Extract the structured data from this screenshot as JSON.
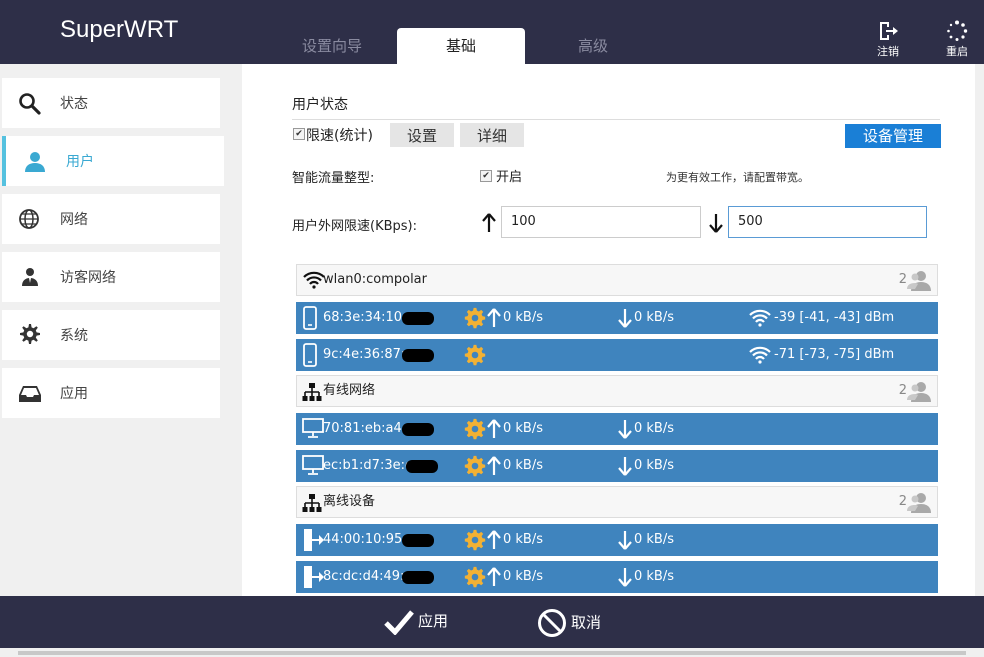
{
  "app": {
    "title": "SuperWRT"
  },
  "tabs": [
    {
      "label": "设置向导"
    },
    {
      "label": "基础",
      "active": true
    },
    {
      "label": "高级"
    }
  ],
  "top_actions": {
    "logout": "注销",
    "reboot": "重启"
  },
  "sidebar": {
    "items": [
      {
        "label": "状态",
        "icon": "search-icon"
      },
      {
        "label": "用户",
        "icon": "user-icon",
        "active": true
      },
      {
        "label": "网络",
        "icon": "globe-icon"
      },
      {
        "label": "访客网络",
        "icon": "guest-icon"
      },
      {
        "label": "系统",
        "icon": "gear-icon"
      },
      {
        "label": "应用",
        "icon": "inbox-icon"
      }
    ]
  },
  "user_status": {
    "title": "用户状态",
    "rate_limit_label": "限速(统计)",
    "rate_limit_checked": true,
    "settings_button": "设置",
    "details_button": "详细",
    "device_manage_button": "设备管理",
    "smart_shaping_label": "智能流量整型:",
    "smart_shaping_enable": "开启",
    "smart_shaping_checked": true,
    "bandwidth_hint": "为更有效工作，请配置带宽。",
    "limit_label": "用户外网限速(KBps):",
    "up_limit": "100",
    "down_limit": "500"
  },
  "groups": [
    {
      "name": "wlan0:compolar",
      "count": "2",
      "icon": "wifi-icon",
      "devices": [
        {
          "mac": "68:3e:34:10:",
          "type": "phone",
          "up": "0 kB/s",
          "down": "0 kB/s",
          "signal": "-39 [-41, -43] dBm"
        },
        {
          "mac": "9c:4e:36:87:",
          "type": "phone",
          "up": "",
          "down": "",
          "signal": "-71 [-73, -75] dBm"
        }
      ]
    },
    {
      "name": "有线网络",
      "count": "2",
      "icon": "network-icon",
      "devices": [
        {
          "mac": "70:81:eb:a4:",
          "type": "monitor",
          "up": "0 kB/s",
          "down": "0 kB/s",
          "signal": ""
        },
        {
          "mac": "ec:b1:d7:3e:c",
          "type": "monitor",
          "up": "0 kB/s",
          "down": "0 kB/s",
          "signal": ""
        }
      ]
    },
    {
      "name": "离线设备",
      "count": "2",
      "icon": "network-icon",
      "devices": [
        {
          "mac": "44:00:10:95:",
          "type": "offline",
          "up": "0 kB/s",
          "down": "0 kB/s",
          "signal": ""
        },
        {
          "mac": "8c:dc:d4:49:",
          "type": "offline",
          "up": "0 kB/s",
          "down": "0 kB/s",
          "signal": ""
        }
      ]
    }
  ],
  "footer": {
    "apply": "应用",
    "cancel": "取消"
  },
  "colors": {
    "header": "#2e2f48",
    "device_row": "#3f84be",
    "accent": "#1a7fd6",
    "active_side": "#3aa9d2"
  }
}
